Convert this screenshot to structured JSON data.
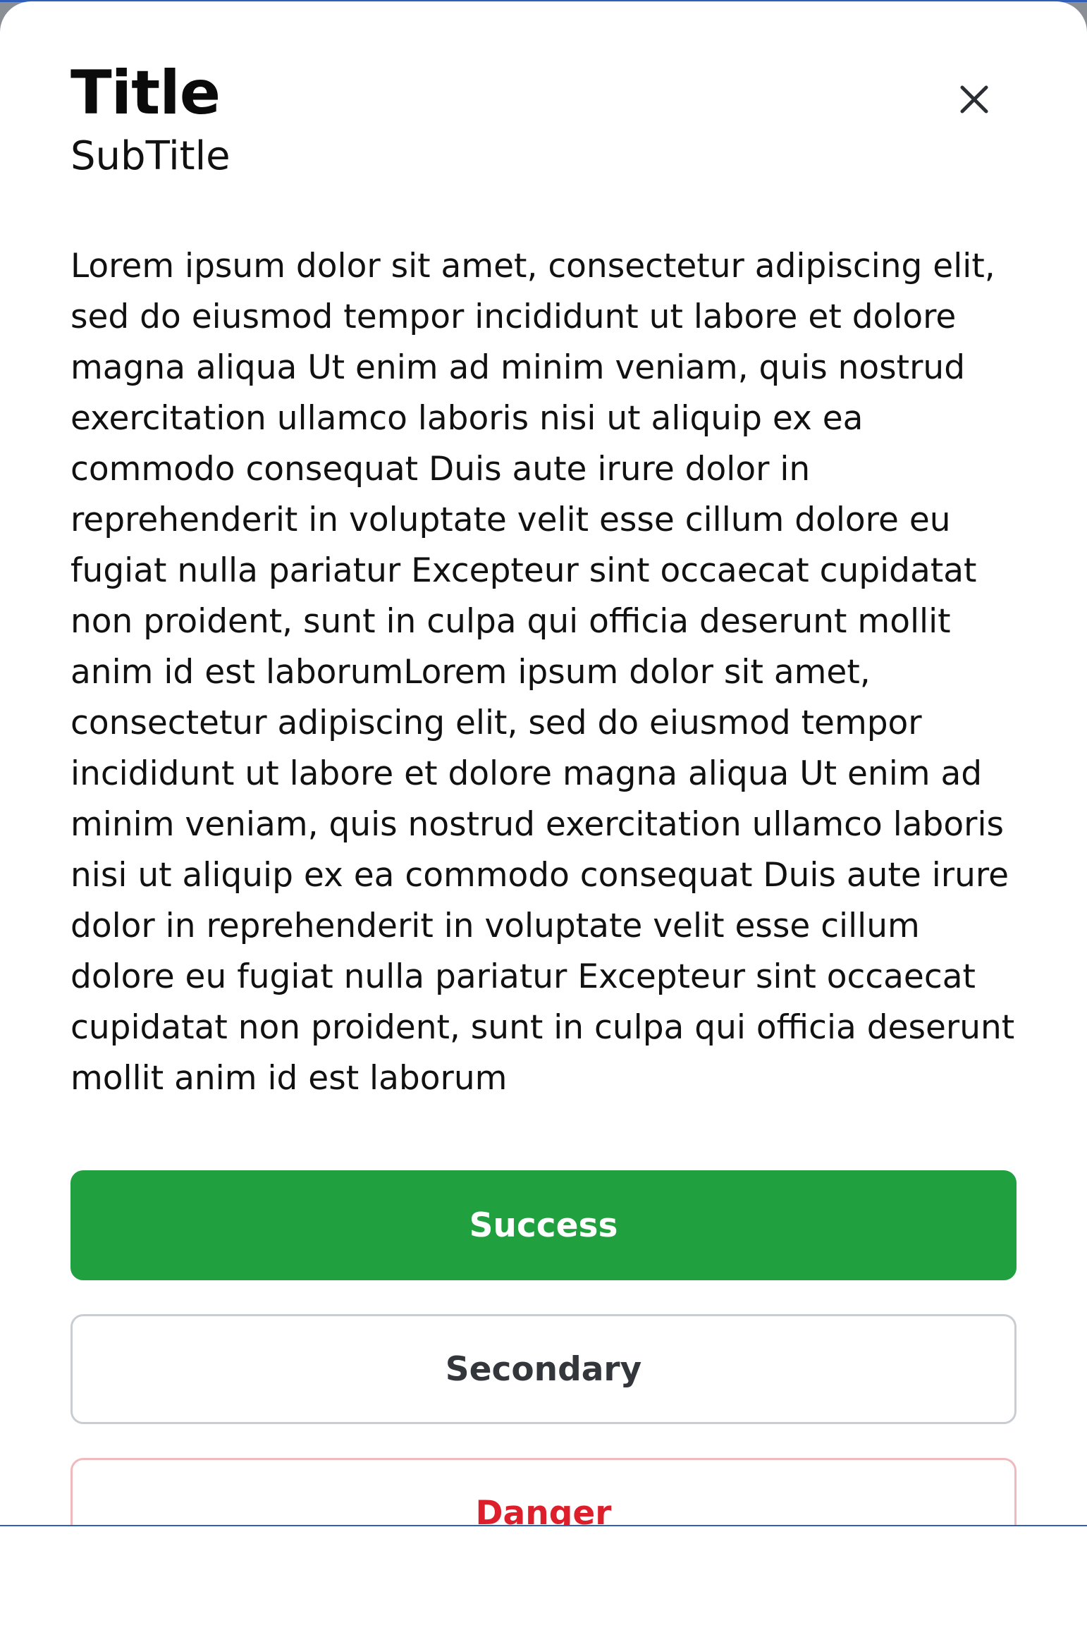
{
  "modal": {
    "title": "Title",
    "subtitle": "SubTitle",
    "body_text": "Lorem ipsum dolor sit amet, consectetur adipiscing elit, sed do eiusmod tempor incididunt ut labore et dolore magna aliqua Ut enim ad minim veniam, quis nostrud exercitation ullamco laboris nisi ut aliquip ex ea commodo consequat Duis aute irure dolor in reprehenderit in voluptate velit esse cillum dolore eu fugiat nulla pariatur Excepteur sint occaecat cupidatat non proident, sunt in culpa qui officia deserunt mollit anim id est laborumLorem ipsum dolor sit amet, consectetur adipiscing elit, sed do eiusmod tempor incididunt ut labore et dolore magna aliqua Ut enim ad minim veniam, quis nostrud exercitation ullamco laboris nisi ut aliquip ex ea commodo consequat Duis aute irure dolor in reprehenderit in voluptate velit esse cillum dolore eu fugiat nulla pariatur Excepteur sint occaecat cupidatat non proident, sunt in culpa qui officia deserunt mollit anim id est laborum",
    "close_icon": "close-icon"
  },
  "actions": {
    "success_label": "Success",
    "secondary_label": "Secondary",
    "danger_label": "Danger"
  },
  "colors": {
    "success": "#21a03f",
    "secondary_text": "#33373b",
    "secondary_border": "#c9cdd1",
    "danger": "#dc1f2b",
    "danger_border": "#f0b9bd",
    "edge_accent": "#2f5fb8"
  }
}
